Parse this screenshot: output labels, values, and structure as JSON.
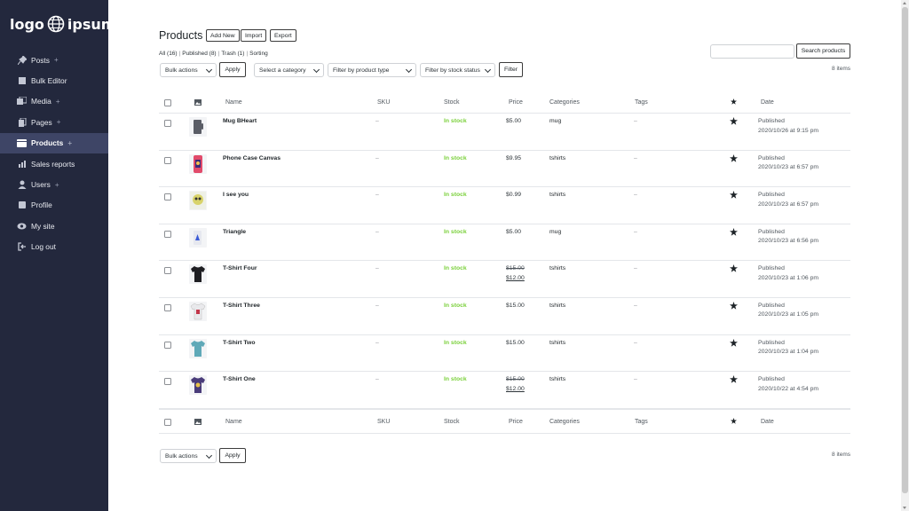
{
  "brand": {
    "logo_left": "logo",
    "logo_right": "ipsum",
    "tm": "®"
  },
  "sidebar": {
    "items": [
      {
        "label": "Posts",
        "icon": "pin-icon",
        "plus": true,
        "active": false
      },
      {
        "label": "Bulk Editor",
        "icon": "edit-icon",
        "plus": false,
        "active": false
      },
      {
        "label": "Media",
        "icon": "media-icon",
        "plus": true,
        "active": false
      },
      {
        "label": "Pages",
        "icon": "pages-icon",
        "plus": true,
        "active": false
      },
      {
        "label": "Products",
        "icon": "products-icon",
        "plus": true,
        "active": true
      },
      {
        "label": "Sales reports",
        "icon": "chart-icon",
        "plus": false,
        "active": false
      },
      {
        "label": "Users",
        "icon": "user-icon",
        "plus": true,
        "active": false
      },
      {
        "label": "Profile",
        "icon": "profile-icon",
        "plus": false,
        "active": false
      },
      {
        "label": "My site",
        "icon": "eye-icon",
        "plus": false,
        "active": false
      },
      {
        "label": "Log out",
        "icon": "logout-icon",
        "plus": false,
        "active": false
      }
    ]
  },
  "header": {
    "title": "Products",
    "add_new": "Add New",
    "import": "Import",
    "export": "Export"
  },
  "filters_links": {
    "all": "All (16)",
    "published": "Published (8)",
    "trash": "Trash (1)",
    "sorting": "Sorting"
  },
  "search": {
    "button": "Search products",
    "placeholder": ""
  },
  "toolbar_top": {
    "bulk": "Bulk actions",
    "apply": "Apply",
    "category": "Select a category",
    "type": "Filter by product type",
    "stock": "Filter by stock status",
    "filter": "Filter",
    "count": "8 items"
  },
  "toolbar_bottom": {
    "bulk": "Bulk actions",
    "apply": "Apply",
    "count": "8 items"
  },
  "columns": {
    "name": "Name",
    "sku": "SKU",
    "stock": "Stock",
    "price": "Price",
    "categories": "Categories",
    "tags": "Tags",
    "date": "Date"
  },
  "rows": [
    {
      "name": "Mug BHeart",
      "sku": "–",
      "stock": "In stock",
      "price": "$5.00",
      "old_price": "",
      "categories": "mug",
      "tags": "–",
      "status": "Published",
      "date": "2020/10/26 at 9:15 pm",
      "thumb": "mug-thumb"
    },
    {
      "name": "Phone Case Canvas",
      "sku": "–",
      "stock": "In stock",
      "price": "$9.95",
      "old_price": "",
      "categories": "tshirts",
      "tags": "–",
      "status": "Published",
      "date": "2020/10/23 at 6:57 pm",
      "thumb": "phone-case-thumb"
    },
    {
      "name": "I see you",
      "sku": "–",
      "stock": "In stock",
      "price": "$0.99",
      "old_price": "",
      "categories": "tshirts",
      "tags": "–",
      "status": "Published",
      "date": "2020/10/23 at 6:57 pm",
      "thumb": "art-thumb"
    },
    {
      "name": "Triangle",
      "sku": "–",
      "stock": "In stock",
      "price": "$5.00",
      "old_price": "",
      "categories": "mug",
      "tags": "–",
      "status": "Published",
      "date": "2020/10/23 at 6:56 pm",
      "thumb": "mug-blue-thumb"
    },
    {
      "name": "T-Shirt Four",
      "sku": "–",
      "stock": "In stock",
      "price": "$12.00",
      "old_price": "$15.00",
      "categories": "tshirts",
      "tags": "–",
      "status": "Published",
      "date": "2020/10/23 at 1:06 pm",
      "thumb": "tshirt-black-thumb"
    },
    {
      "name": "T-Shirt Three",
      "sku": "–",
      "stock": "In stock",
      "price": "$15.00",
      "old_price": "",
      "categories": "tshirts",
      "tags": "–",
      "status": "Published",
      "date": "2020/10/23 at 1:05 pm",
      "thumb": "tshirt-white-thumb"
    },
    {
      "name": "T-Shirt Two",
      "sku": "–",
      "stock": "In stock",
      "price": "$15.00",
      "old_price": "",
      "categories": "tshirts",
      "tags": "–",
      "status": "Published",
      "date": "2020/10/23 at 1:04 pm",
      "thumb": "tshirt-teal-thumb"
    },
    {
      "name": "T-Shirt One",
      "sku": "–",
      "stock": "In stock",
      "price": "$12.00",
      "old_price": "$15.00",
      "categories": "tshirts",
      "tags": "–",
      "status": "Published",
      "date": "2020/10/22 at 4:54 pm",
      "thumb": "tshirt-purple-thumb"
    }
  ],
  "colors": {
    "sidebar_bg": "#23283d",
    "sidebar_active": "#3e4566",
    "in_stock": "#7ad03a",
    "text": "#1d2327"
  }
}
